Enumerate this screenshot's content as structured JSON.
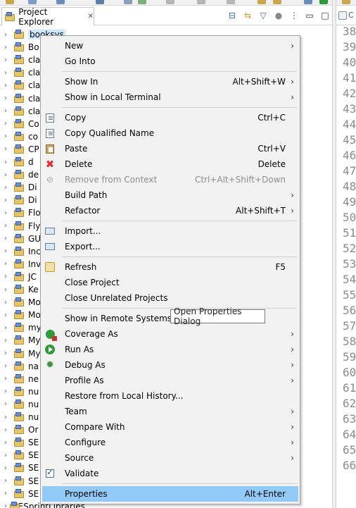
{
  "view": {
    "tab_label": "Project Explorer",
    "tab_close": "✕",
    "editor_tab_label": "C"
  },
  "tree": {
    "projects": [
      "booksys",
      "Bo",
      "cla",
      "cla",
      "cla",
      "cla",
      "cla",
      "Co",
      "co",
      "CP",
      "d",
      "de",
      "Di",
      "Di",
      "Flo",
      "Fly",
      "GU",
      "Inc",
      "Inv",
      "JC",
      "Ke",
      "Mo",
      "Mo",
      "my",
      "My",
      "My",
      "na",
      "ne",
      "nu",
      "nu",
      "nu",
      "Or",
      "SE",
      "SE",
      "SE",
      "SE",
      "SE",
      "SESprintLibraries"
    ],
    "selected_index": 0
  },
  "line_numbers": [
    "38",
    "39",
    "40",
    "41",
    "42",
    "43",
    "44",
    "45",
    "46",
    "47",
    "48",
    "49",
    "50",
    "51",
    "52",
    "53",
    "54",
    "55",
    "56",
    "57",
    "58",
    "59",
    "60",
    "61",
    "62",
    "63",
    "64",
    "65",
    "66"
  ],
  "menu": {
    "items": [
      {
        "label": "New",
        "shortcut": "",
        "submenu": true,
        "icon": "",
        "disabled": false
      },
      {
        "label": "Go Into",
        "shortcut": "",
        "submenu": false,
        "icon": "",
        "disabled": false
      },
      {
        "label": "Show In",
        "shortcut": "Alt+Shift+W",
        "submenu": true,
        "icon": "",
        "disabled": false
      },
      {
        "label": "Show in Local Terminal",
        "shortcut": "",
        "submenu": true,
        "icon": "",
        "disabled": false
      },
      {
        "label": "Copy",
        "shortcut": "Ctrl+C",
        "submenu": false,
        "icon": "copy-icon",
        "disabled": false
      },
      {
        "label": "Copy Qualified Name",
        "shortcut": "",
        "submenu": false,
        "icon": "copy-qualified-icon",
        "disabled": false
      },
      {
        "label": "Paste",
        "shortcut": "Ctrl+V",
        "submenu": false,
        "icon": "paste-icon",
        "disabled": false
      },
      {
        "label": "Delete",
        "shortcut": "Delete",
        "submenu": false,
        "icon": "delete-icon",
        "disabled": false
      },
      {
        "label": "Remove from Context",
        "shortcut": "Ctrl+Alt+Shift+Down",
        "submenu": false,
        "icon": "remove-icon",
        "disabled": true
      },
      {
        "label": "Build Path",
        "shortcut": "",
        "submenu": true,
        "icon": "",
        "disabled": false
      },
      {
        "label": "Refactor",
        "shortcut": "Alt+Shift+T",
        "submenu": true,
        "icon": "",
        "disabled": false
      },
      {
        "label": "Import...",
        "shortcut": "",
        "submenu": false,
        "icon": "import-icon",
        "disabled": false
      },
      {
        "label": "Export...",
        "shortcut": "",
        "submenu": false,
        "icon": "export-icon",
        "disabled": false
      },
      {
        "label": "Refresh",
        "shortcut": "F5",
        "submenu": false,
        "icon": "refresh-icon",
        "disabled": false
      },
      {
        "label": "Close Project",
        "shortcut": "",
        "submenu": false,
        "icon": "",
        "disabled": false
      },
      {
        "label": "Close Unrelated Projects",
        "shortcut": "",
        "submenu": false,
        "icon": "",
        "disabled": false
      },
      {
        "label": "Show in Remote Systems vi",
        "shortcut": "",
        "submenu": false,
        "icon": "",
        "disabled": false
      },
      {
        "label": "Coverage As",
        "shortcut": "",
        "submenu": true,
        "icon": "coverage-icon",
        "disabled": false
      },
      {
        "label": "Run As",
        "shortcut": "",
        "submenu": true,
        "icon": "run-icon",
        "disabled": false
      },
      {
        "label": "Debug As",
        "shortcut": "",
        "submenu": true,
        "icon": "debug-icon",
        "disabled": false
      },
      {
        "label": "Profile As",
        "shortcut": "",
        "submenu": true,
        "icon": "",
        "disabled": false
      },
      {
        "label": "Restore from Local History...",
        "shortcut": "",
        "submenu": false,
        "icon": "",
        "disabled": false
      },
      {
        "label": "Team",
        "shortcut": "",
        "submenu": true,
        "icon": "",
        "disabled": false
      },
      {
        "label": "Compare With",
        "shortcut": "",
        "submenu": true,
        "icon": "",
        "disabled": false
      },
      {
        "label": "Configure",
        "shortcut": "",
        "submenu": true,
        "icon": "",
        "disabled": false
      },
      {
        "label": "Source",
        "shortcut": "",
        "submenu": true,
        "icon": "",
        "disabled": false
      },
      {
        "label": "Validate",
        "shortcut": "",
        "submenu": false,
        "icon": "validate-check-icon",
        "disabled": false
      },
      {
        "label": "Properties",
        "shortcut": "Alt+Enter",
        "submenu": false,
        "icon": "",
        "disabled": false
      }
    ],
    "highlighted": "Properties"
  },
  "tooltip": {
    "text": "Open Properties Dialog"
  },
  "colors": {
    "menu_background": "#f2f2f2",
    "highlight": "#91c9f7",
    "selection": "#cde8ff"
  }
}
